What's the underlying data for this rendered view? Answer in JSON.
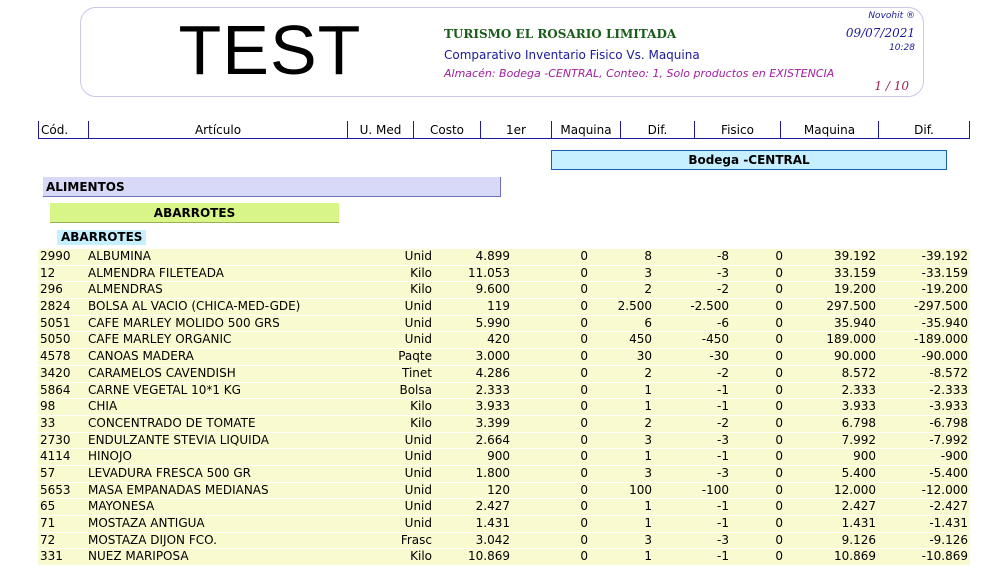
{
  "header": {
    "logo_text": "TEST",
    "company": "TURISMO EL ROSARIO LIMITADA",
    "report_title": "Comparativo Inventario Fisico Vs. Maquina",
    "report_subtitle": "Almacén: Bodega -CENTRAL, Conteo: 1, Solo productos en EXISTENCIA",
    "brand": "Novohit ®",
    "date": "09/07/2021",
    "time": "10:28",
    "page": "1 / 10"
  },
  "columns": [
    "Cód.",
    "Artículo",
    "U. Med",
    "Costo",
    "1er",
    "Maquina",
    "Dif.",
    "Fisico",
    "Maquina",
    "Dif."
  ],
  "bodega": "Bodega -CENTRAL",
  "group": "ALIMENTOS",
  "subgroup": "ABARROTES",
  "subsubgroup": "ABARROTES",
  "rows": [
    {
      "code": "2990",
      "name": "ALBUMINA",
      "um": "Unid",
      "cost": "4.899",
      "first": "0",
      "maq": "8",
      "dif": "-8",
      "fis": "0",
      "vmaq": "39.192",
      "vdif": "-39.192"
    },
    {
      "code": "12",
      "name": "ALMENDRA FILETEADA",
      "um": "Kilo",
      "cost": "11.053",
      "first": "0",
      "maq": "3",
      "dif": "-3",
      "fis": "0",
      "vmaq": "33.159",
      "vdif": "-33.159"
    },
    {
      "code": "296",
      "name": "ALMENDRAS",
      "um": "Kilo",
      "cost": "9.600",
      "first": "0",
      "maq": "2",
      "dif": "-2",
      "fis": "0",
      "vmaq": "19.200",
      "vdif": "-19.200"
    },
    {
      "code": "2824",
      "name": "BOLSA AL VACIO (CHICA-MED-GDE)",
      "um": "Unid",
      "cost": "119",
      "first": "0",
      "maq": "2.500",
      "dif": "-2.500",
      "fis": "0",
      "vmaq": "297.500",
      "vdif": "-297.500"
    },
    {
      "code": "5051",
      "name": "CAFE MARLEY MOLIDO 500 GRS",
      "um": "Unid",
      "cost": "5.990",
      "first": "0",
      "maq": "6",
      "dif": "-6",
      "fis": "0",
      "vmaq": "35.940",
      "vdif": "-35.940"
    },
    {
      "code": "5050",
      "name": "CAFE MARLEY ORGANIC",
      "um": "Unid",
      "cost": "420",
      "first": "0",
      "maq": "450",
      "dif": "-450",
      "fis": "0",
      "vmaq": "189.000",
      "vdif": "-189.000"
    },
    {
      "code": "4578",
      "name": "CANOAS MADERA",
      "um": "Paqte",
      "cost": "3.000",
      "first": "0",
      "maq": "30",
      "dif": "-30",
      "fis": "0",
      "vmaq": "90.000",
      "vdif": "-90.000"
    },
    {
      "code": "3420",
      "name": "CARAMELOS CAVENDISH",
      "um": "Tinet",
      "cost": "4.286",
      "first": "0",
      "maq": "2",
      "dif": "-2",
      "fis": "0",
      "vmaq": "8.572",
      "vdif": "-8.572"
    },
    {
      "code": "5864",
      "name": "CARNE VEGETAL 10*1 KG",
      "um": "Bolsa",
      "cost": "2.333",
      "first": "0",
      "maq": "1",
      "dif": "-1",
      "fis": "0",
      "vmaq": "2.333",
      "vdif": "-2.333"
    },
    {
      "code": "98",
      "name": "CHIA",
      "um": "Kilo",
      "cost": "3.933",
      "first": "0",
      "maq": "1",
      "dif": "-1",
      "fis": "0",
      "vmaq": "3.933",
      "vdif": "-3.933"
    },
    {
      "code": "33",
      "name": "CONCENTRADO DE TOMATE",
      "um": "Kilo",
      "cost": "3.399",
      "first": "0",
      "maq": "2",
      "dif": "-2",
      "fis": "0",
      "vmaq": "6.798",
      "vdif": "-6.798"
    },
    {
      "code": "2730",
      "name": "ENDULZANTE STEVIA LIQUIDA",
      "um": "Unid",
      "cost": "2.664",
      "first": "0",
      "maq": "3",
      "dif": "-3",
      "fis": "0",
      "vmaq": "7.992",
      "vdif": "-7.992"
    },
    {
      "code": "4114",
      "name": "HINOJO",
      "um": "Unid",
      "cost": "900",
      "first": "0",
      "maq": "1",
      "dif": "-1",
      "fis": "0",
      "vmaq": "900",
      "vdif": "-900"
    },
    {
      "code": "57",
      "name": "LEVADURA FRESCA 500 GR",
      "um": "Unid",
      "cost": "1.800",
      "first": "0",
      "maq": "3",
      "dif": "-3",
      "fis": "0",
      "vmaq": "5.400",
      "vdif": "-5.400"
    },
    {
      "code": "5653",
      "name": "MASA EMPANADAS MEDIANAS",
      "um": "Unid",
      "cost": "120",
      "first": "0",
      "maq": "100",
      "dif": "-100",
      "fis": "0",
      "vmaq": "12.000",
      "vdif": "-12.000"
    },
    {
      "code": "65",
      "name": "MAYONESA",
      "um": "Unid",
      "cost": "2.427",
      "first": "0",
      "maq": "1",
      "dif": "-1",
      "fis": "0",
      "vmaq": "2.427",
      "vdif": "-2.427"
    },
    {
      "code": "71",
      "name": "MOSTAZA ANTIGUA",
      "um": "Unid",
      "cost": "1.431",
      "first": "0",
      "maq": "1",
      "dif": "-1",
      "fis": "0",
      "vmaq": "1.431",
      "vdif": "-1.431"
    },
    {
      "code": "72",
      "name": "MOSTAZA DIJON FCO.",
      "um": "Frasc",
      "cost": "3.042",
      "first": "0",
      "maq": "3",
      "dif": "-3",
      "fis": "0",
      "vmaq": "9.126",
      "vdif": "-9.126"
    },
    {
      "code": "331",
      "name": "NUEZ MARIPOSA",
      "um": "Kilo",
      "cost": "10.869",
      "first": "0",
      "maq": "1",
      "dif": "-1",
      "fis": "0",
      "vmaq": "10.869",
      "vdif": "-10.869"
    }
  ]
}
